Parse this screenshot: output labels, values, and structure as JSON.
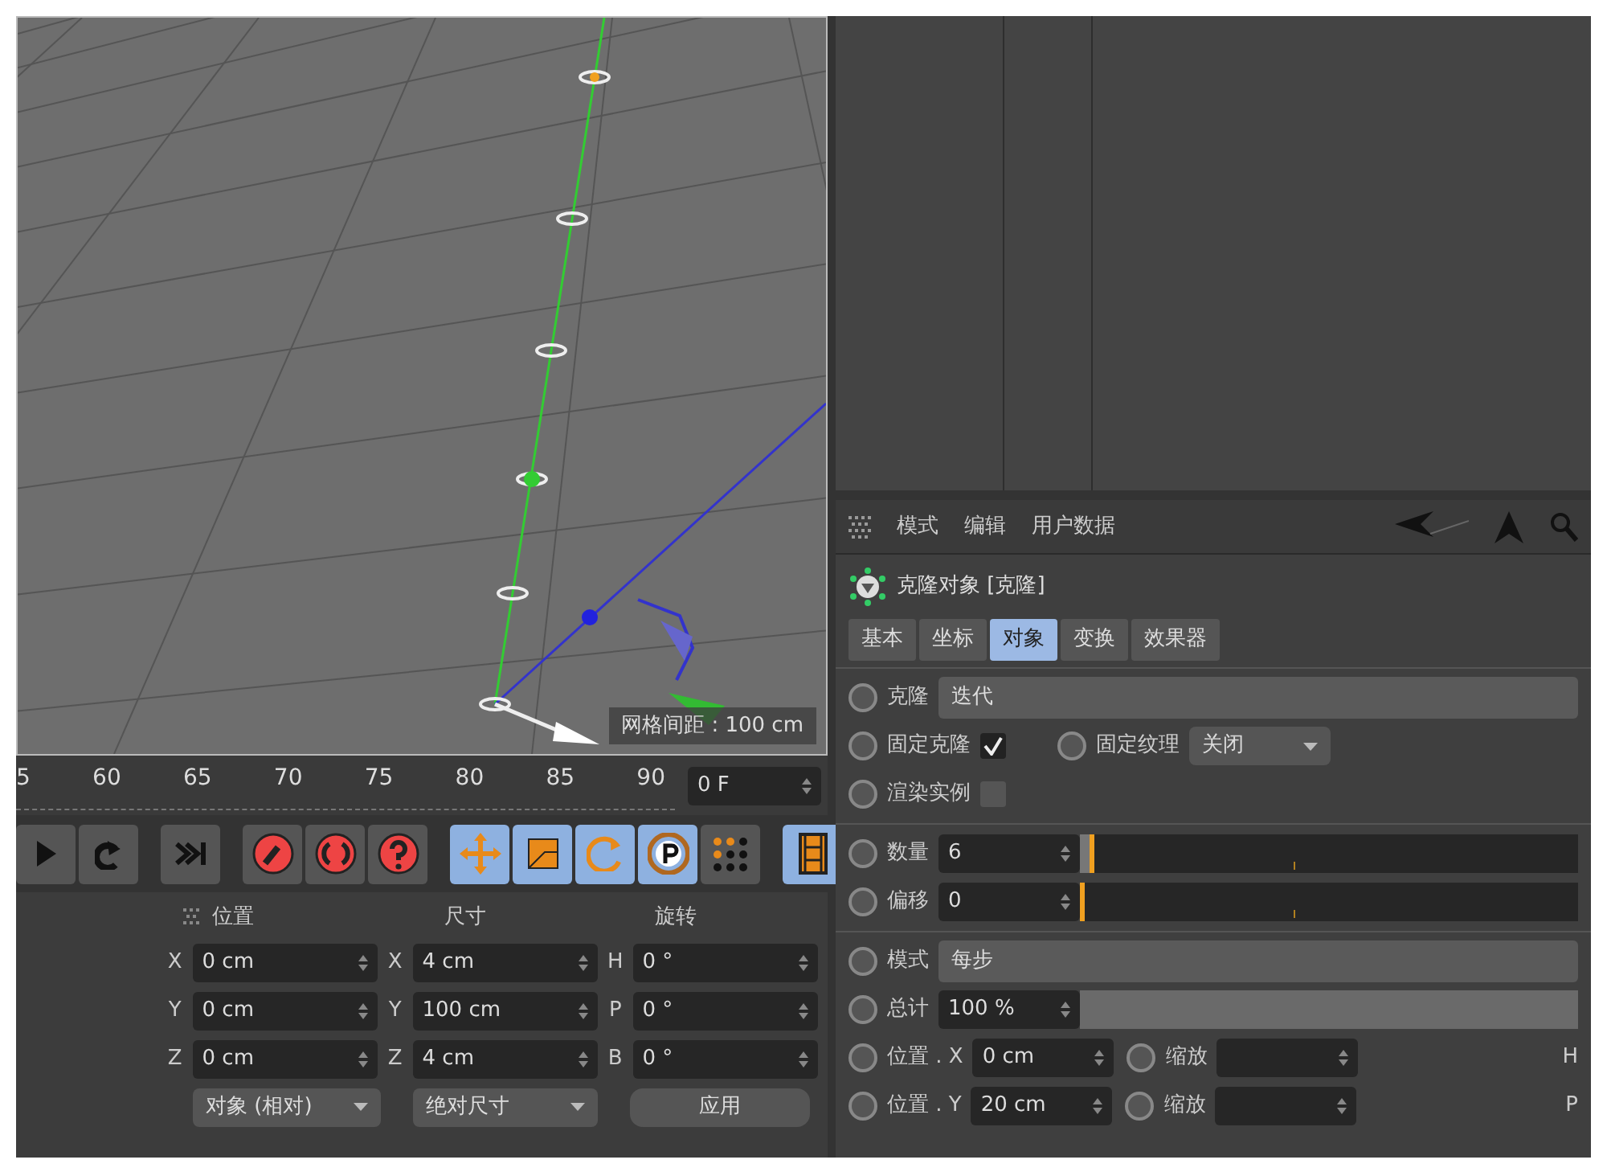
{
  "viewport": {
    "grid_spacing_label": "网格间距 : 100 cm"
  },
  "timeline": {
    "ticks": [
      "5",
      "60",
      "65",
      "70",
      "75",
      "80",
      "85",
      "90"
    ],
    "frame_field": "0 F"
  },
  "toolbar": {
    "groups": [
      {
        "items": [
          {
            "kind": "play",
            "selected": false
          },
          {
            "kind": "loop",
            "selected": false
          }
        ]
      },
      {
        "items": [
          {
            "kind": "end",
            "selected": false
          }
        ]
      },
      {
        "items": [
          {
            "kind": "key",
            "selected": false
          },
          {
            "kind": "auto",
            "selected": false
          },
          {
            "kind": "help",
            "selected": false
          }
        ]
      },
      {
        "items": [
          {
            "kind": "move",
            "selected": true
          },
          {
            "kind": "scale",
            "selected": true
          },
          {
            "kind": "rotate",
            "selected": true
          },
          {
            "kind": "point",
            "selected": true
          },
          {
            "kind": "dots",
            "selected": false
          }
        ]
      },
      {
        "items": [
          {
            "kind": "film",
            "selected": true
          }
        ]
      }
    ]
  },
  "coordinates": {
    "headers": [
      "位置",
      "尺寸",
      "旋转"
    ],
    "rows": [
      {
        "cells": [
          {
            "axis": "X",
            "value": "0 cm"
          },
          {
            "axis": "X",
            "value": "4 cm"
          },
          {
            "axis": "H",
            "value": "0 °"
          }
        ]
      },
      {
        "cells": [
          {
            "axis": "Y",
            "value": "0 cm"
          },
          {
            "axis": "Y",
            "value": "100 cm"
          },
          {
            "axis": "P",
            "value": "0 °"
          }
        ]
      },
      {
        "cells": [
          {
            "axis": "Z",
            "value": "0 cm"
          },
          {
            "axis": "Z",
            "value": "4 cm"
          },
          {
            "axis": "B",
            "value": "0 °"
          }
        ]
      }
    ],
    "footer": {
      "mode_select": "对象 (相对)",
      "size_select": "绝对尺寸",
      "apply_button": "应用"
    }
  },
  "attributes": {
    "menu": [
      "模式",
      "编辑",
      "用户数据"
    ],
    "title": "克隆对象 [克隆]",
    "tabs": [
      {
        "label": "基本",
        "selected": false
      },
      {
        "label": "坐标",
        "selected": false
      },
      {
        "label": "对象",
        "selected": true
      },
      {
        "label": "变换",
        "selected": false
      },
      {
        "label": "效果器",
        "selected": false
      }
    ],
    "sections": [
      [
        {
          "fields": [
            {
              "kind": "combo",
              "label": "克隆",
              "value": "迭代"
            }
          ]
        },
        {
          "fields": [
            {
              "kind": "checkbox",
              "label": "固定克隆",
              "checked": true
            },
            {
              "kind": "select",
              "label": "固定纹理",
              "value": "关闭"
            }
          ]
        },
        {
          "fields": [
            {
              "kind": "checkbox",
              "label": "渲染实例",
              "checked": false
            }
          ]
        }
      ],
      [
        {
          "fields": [
            {
              "kind": "slider",
              "label": "数量",
              "value": "6",
              "level": 0.03
            }
          ]
        },
        {
          "fields": [
            {
              "kind": "slider",
              "label": "偏移",
              "value": "0",
              "level": 0
            }
          ]
        }
      ],
      [
        {
          "fields": [
            {
              "kind": "combo",
              "label": "模式",
              "value": "每步"
            }
          ]
        },
        {
          "fields": [
            {
              "kind": "bar",
              "label": "总计",
              "value": "100 %"
            }
          ]
        },
        {
          "fields": [
            {
              "kind": "number",
              "label": "位置 . X",
              "value": "0 cm"
            },
            {
              "kind": "number",
              "label": "缩放"
            },
            {
              "kind": "axis",
              "label": "H"
            }
          ]
        },
        {
          "fields": [
            {
              "kind": "number",
              "label": "位置 . Y",
              "value": "20 cm"
            },
            {
              "kind": "number",
              "label": "缩放"
            },
            {
              "kind": "axis",
              "label": "P"
            }
          ]
        }
      ]
    ]
  }
}
